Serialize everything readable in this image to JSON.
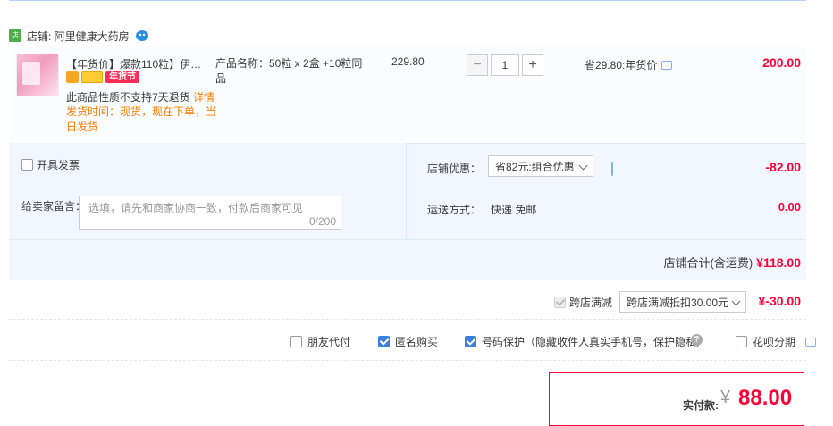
{
  "shop": {
    "icon_text": "店",
    "label": "店铺: 阿里健康大药房"
  },
  "item": {
    "title": "【年货价】爆款110粒】伊可新…",
    "festival_badge": "年货节",
    "no_return": "此商品性质不支持7天退货",
    "no_return_link": "详情",
    "ship_time": "发货时间：现货，现在下单，当日发货",
    "spec": "产品名称：50粒 x 2盒 +10粒同品",
    "price": "229.80",
    "quantity": "1",
    "qty_minus": "−",
    "qty_plus": "+",
    "promo": "省29.80:年货价",
    "subtotal": "200.00"
  },
  "options": {
    "invoice_label": "开具发票",
    "message_label": "给卖家留言：",
    "message_placeholder": "选填，请先和商家协商一致，付款后商家可见",
    "message_count": "0/200",
    "coupon_label": "店铺优惠：",
    "coupon_value": "省82元:组合优惠",
    "coupon_amount": "-82.00",
    "ship_label": "运送方式：",
    "ship_value": "快递 免邮",
    "ship_fee": "0.00"
  },
  "shop_total": {
    "label": "店铺合计(含运费)",
    "amount": "¥118.00"
  },
  "cross_store": {
    "label": "跨店满减",
    "select_value": "跨店满减抵扣30.00元",
    "amount": "¥-30.00"
  },
  "extras": {
    "friend_pay": "朋友代付",
    "anonymous": "匿名购买",
    "number_protect": "号码保护（隐藏收件人真实手机号，保护隐私）",
    "huabei": "花呗分期"
  },
  "payment": {
    "label": "实付款:",
    "currency": "¥",
    "amount": "88.00"
  }
}
